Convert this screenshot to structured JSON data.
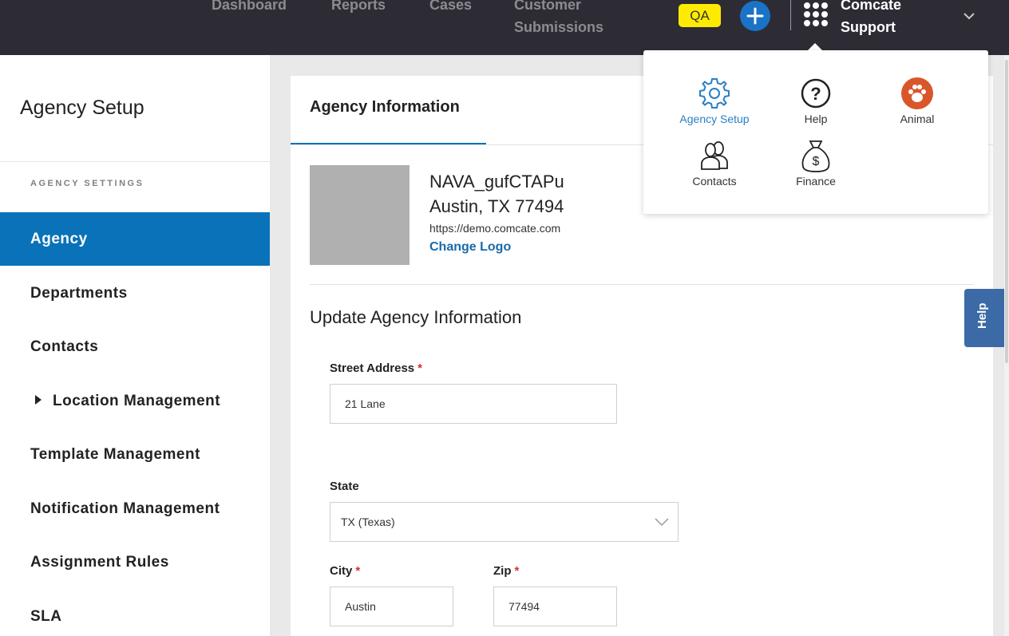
{
  "topbar": {
    "nav": [
      "Dashboard",
      "Reports",
      "Cases",
      "Customer",
      "Submissions"
    ],
    "env_badge": "QA",
    "account_line1": "Comcate",
    "account_line2": "Support"
  },
  "sidebar": {
    "title": "Agency Setup",
    "section": "AGENCY SETTINGS",
    "items": [
      "Agency",
      "Departments",
      "Contacts",
      "Location Management",
      "Template Management",
      "Notification Management",
      "Assignment Rules",
      "SLA"
    ]
  },
  "main": {
    "tab": "Agency Information",
    "agency_name": "NAVA_gufCTAPu",
    "agency_address": "Austin, TX 77494",
    "agency_url": "https://demo.comcate.com",
    "change_logo": "Change Logo",
    "update_title": "Update Agency Information",
    "form": {
      "street_label": "Street Address",
      "street_value": "21 Lane",
      "state_label": "State",
      "state_value": "TX (Texas)",
      "city_label": "City",
      "city_value": "Austin",
      "zip_label": "Zip",
      "zip_value": "77494",
      "required_mark": "*"
    }
  },
  "help_tab": "Help",
  "apps_menu": {
    "items": [
      "Agency Setup",
      "Help",
      "Animal",
      "Contacts",
      "Finance"
    ],
    "accent": "#2b7fc3",
    "animal_color": "#d9562b"
  },
  "colors": {
    "topbar": "#2d2c35",
    "active_nav": "#0a72b8",
    "badge": "#ffeb00",
    "plus": "#1a73c7"
  }
}
